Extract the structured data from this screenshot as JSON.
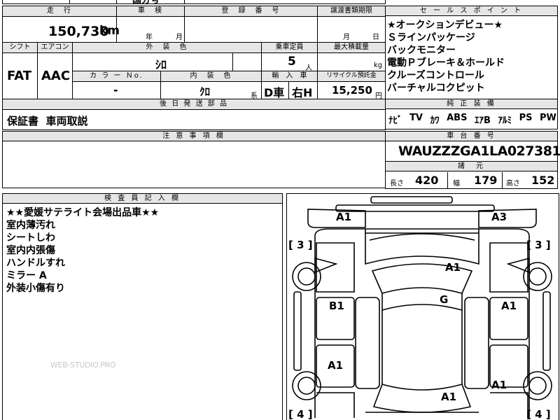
{
  "top_strip": {
    "partial_text": "国分号"
  },
  "mileage": {
    "label": "走　行",
    "value": "150,730",
    "unit": "km"
  },
  "inspection": {
    "label": "車　検",
    "year_unit": "年",
    "month_unit": "月"
  },
  "registration": {
    "label": "登　録　番　号",
    "value": ""
  },
  "transfer": {
    "label": "譲渡書類期限",
    "month_unit": "月",
    "day_unit": "日"
  },
  "shift": {
    "label": "シフト",
    "value": "FAT"
  },
  "aircon": {
    "label": "エアコン",
    "value": "AAC"
  },
  "exterior_color": {
    "label": "外　装　色",
    "value": "ｼﾛ"
  },
  "capacity": {
    "label": "乗車定員",
    "value": "5",
    "unit": "人"
  },
  "max_load": {
    "label": "最大積載量",
    "value": "",
    "unit": "kg"
  },
  "color_no": {
    "label": "カ ラ ー Ｎo.",
    "value": "-"
  },
  "interior_color": {
    "label": "内　装　色",
    "value": "ｸﾛ",
    "suffix": "系"
  },
  "import": {
    "label": "輸　入　車",
    "value": "D車",
    "handle": "右H"
  },
  "recycle": {
    "label": "リサイクル預託金",
    "value": "15,250",
    "unit": "円"
  },
  "later_parts": {
    "label": "後 日 発 送 部 品",
    "value": "保証書  車両取説"
  },
  "notes": {
    "label": "注 意 事 項 欄",
    "value": ""
  },
  "sales_points": {
    "label": "セ ー ル ス ポ イ ン ト",
    "items": [
      "★オークションデビュー★",
      "Ｓラインパッケージ",
      "バックモニター",
      "電動Ｐブレーキ＆ホールド",
      "クルーズコントロール",
      "バーチャルコクピット"
    ]
  },
  "equipment": {
    "label": "純 正 装 備",
    "items": [
      "ﾅﾋﾞ",
      "TV",
      "ｶﾜ",
      "ABS",
      "ｴｱB",
      "ｱﾙﾐ",
      "PS",
      "PW"
    ]
  },
  "chassis": {
    "label": "車 台 番 号",
    "value": "WAUZZZGA1LA027381"
  },
  "specs": {
    "label": "諸　元",
    "length_label": "長さ",
    "length": "420",
    "width_label": "幅",
    "width": "179",
    "height_label": "高さ",
    "height": "152"
  },
  "inspector": {
    "label": "検 査 員 記 入 欄",
    "lines": [
      "★★愛媛サテライト会場出品車★★",
      "室内薄汚れ",
      "シートしわ",
      "室内内張傷",
      "ハンドルすれ",
      "ミラー A",
      "外装小傷有り"
    ]
  },
  "diagram": {
    "marks": {
      "front_left": "A1",
      "front_right": "A3",
      "bonnet": "A1",
      "roof": "G",
      "left_front_door": "B1",
      "right_front_door": "A1",
      "left_rear_door": "A1",
      "right_rear_door": "A1",
      "trunk": "A1"
    },
    "tyre_top_left": "3",
    "tyre_top_right": "3",
    "tyre_bottom_left": "4",
    "tyre_bottom_right": "4"
  },
  "watermark": "WEB-STUDIO.PRO"
}
